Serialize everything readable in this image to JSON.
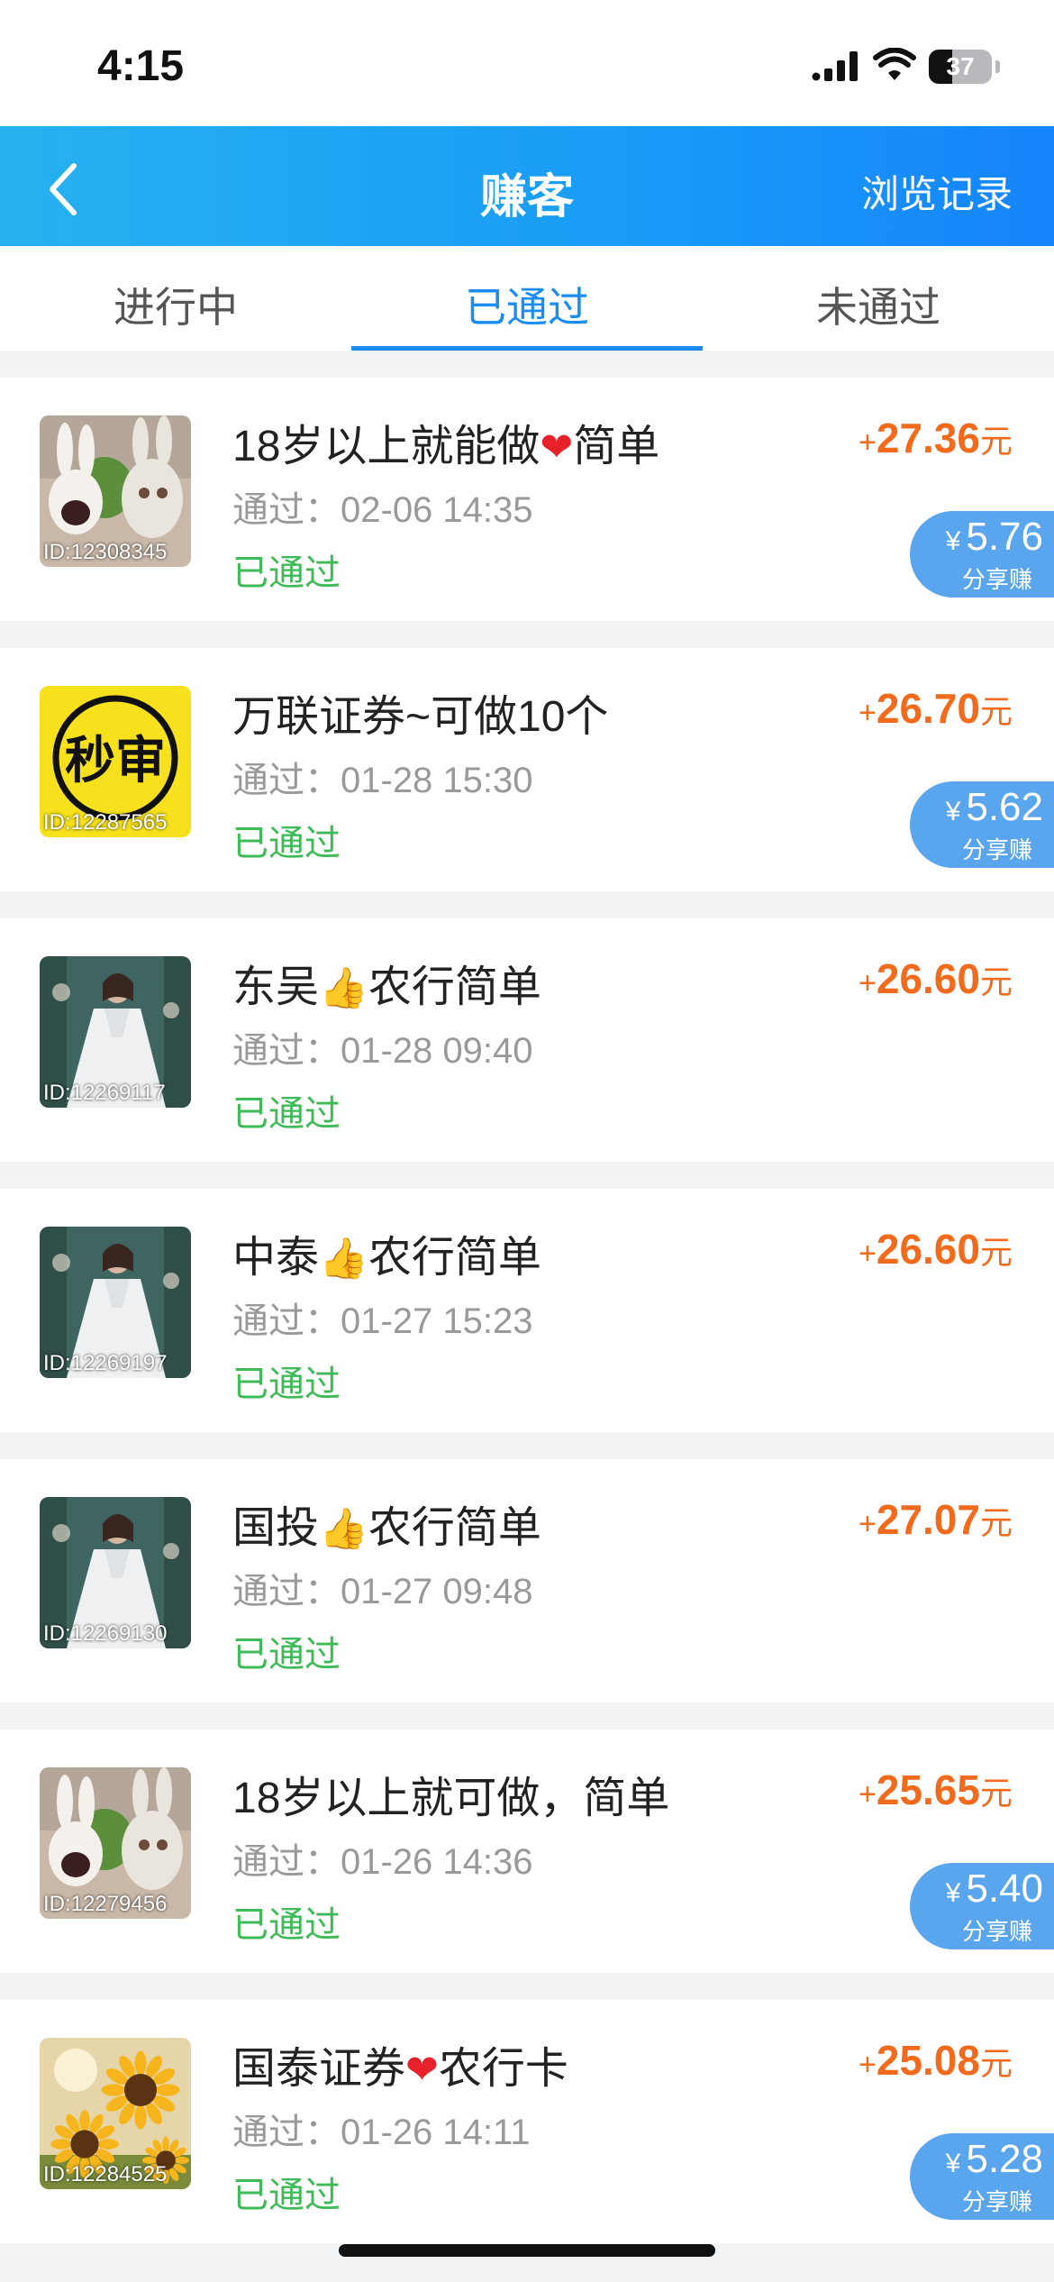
{
  "status_bar": {
    "time": "4:15",
    "battery": "37",
    "battery_level": 0.37
  },
  "nav": {
    "title": "赚客",
    "right_link": "浏览记录"
  },
  "tabs": [
    {
      "label": "进行中",
      "active": false
    },
    {
      "label": "已通过",
      "active": true
    },
    {
      "label": "未通过",
      "active": false
    }
  ],
  "tasks": [
    {
      "thumb": "rabbid-characters",
      "id": "ID:12308345",
      "title": "18岁以上就能做",
      "emoji": "❤",
      "title_suffix": "简单",
      "time_label": "通过：",
      "time": "02-06 14:35",
      "status": "已通过",
      "reward_prefix": "+",
      "reward": "27.36",
      "reward_unit": "元",
      "share": {
        "currency": "¥",
        "amount": "5.76",
        "label": "分享赚"
      }
    },
    {
      "thumb": "miaoshen-badge",
      "thumb_text": "秒审",
      "id": "ID:12287565",
      "title": "万联证券~可做10个",
      "emoji": "",
      "title_suffix": "",
      "time_label": "通过：",
      "time": "01-28 15:30",
      "status": "已通过",
      "reward_prefix": "+",
      "reward": "26.70",
      "reward_unit": "元",
      "share": {
        "currency": "¥",
        "amount": "5.62",
        "label": "分享赚"
      }
    },
    {
      "thumb": "woman-in-white-dress",
      "id": "ID:12269117",
      "title": "东吴",
      "emoji": "👍",
      "title_suffix": "农行简单",
      "time_label": "通过：",
      "time": "01-28 09:40",
      "status": "已通过",
      "reward_prefix": "+",
      "reward": "26.60",
      "reward_unit": "元",
      "share": null
    },
    {
      "thumb": "woman-in-white-dress",
      "id": "ID:12269197",
      "title": "中泰",
      "emoji": "👍",
      "title_suffix": "农行简单",
      "time_label": "通过：",
      "time": "01-27 15:23",
      "status": "已通过",
      "reward_prefix": "+",
      "reward": "26.60",
      "reward_unit": "元",
      "share": null
    },
    {
      "thumb": "woman-in-white-dress",
      "id": "ID:12269130",
      "title": "国投",
      "emoji": "👍",
      "title_suffix": "农行简单",
      "time_label": "通过：",
      "time": "01-27 09:48",
      "status": "已通过",
      "reward_prefix": "+",
      "reward": "27.07",
      "reward_unit": "元",
      "share": null
    },
    {
      "thumb": "rabbid-characters",
      "id": "ID:12279456",
      "title": "18岁以上就可做，简单",
      "emoji": "",
      "title_suffix": "",
      "time_label": "通过：",
      "time": "01-26 14:36",
      "status": "已通过",
      "reward_prefix": "+",
      "reward": "25.65",
      "reward_unit": "元",
      "share": {
        "currency": "¥",
        "amount": "5.40",
        "label": "分享赚"
      }
    },
    {
      "thumb": "sunflowers",
      "id": "ID:12284525",
      "title": "国泰证券",
      "emoji": "❤",
      "title_suffix": "农行卡",
      "time_label": "通过：",
      "time": "01-26 14:11",
      "status": "已通过",
      "reward_prefix": "+",
      "reward": "25.08",
      "reward_unit": "元",
      "share": {
        "currency": "¥",
        "amount": "5.28",
        "label": "分享赚"
      }
    }
  ],
  "colors": {
    "nav_gradient_start": "#27b1f0",
    "nav_gradient_end": "#1585fb",
    "tab_active": "#1a8cf2",
    "reward": "#f26b1d",
    "status_passed": "#3fba57",
    "share_pill": "#5aa6ee",
    "heart": "#e8202a",
    "thumbs_up": "#f6b40e"
  },
  "icons": {
    "back": "chevron-left-icon",
    "signal": "cellular-signal-icon",
    "wifi": "wifi-icon",
    "battery": "battery-icon"
  }
}
